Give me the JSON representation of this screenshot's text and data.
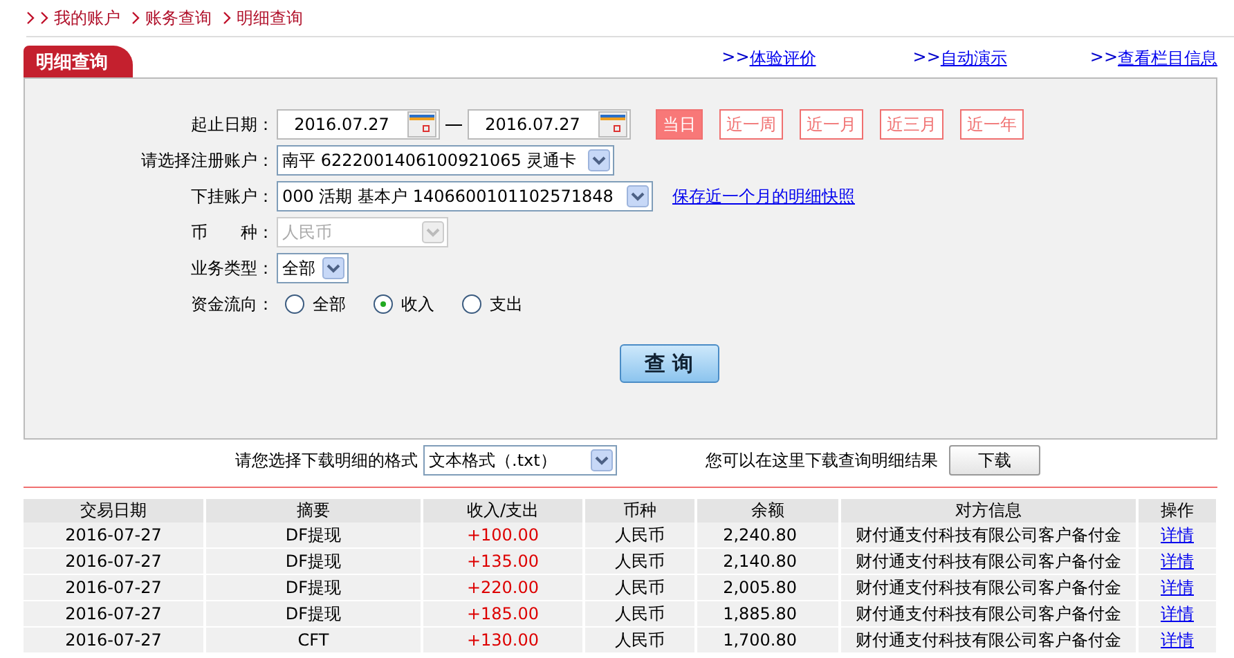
{
  "breadcrumb": [
    "我的账户",
    "账务查询",
    "明细查询"
  ],
  "tab": {
    "label": "明细查询"
  },
  "links": [
    {
      "prefix": ">>",
      "label": "体验评价"
    },
    {
      "prefix": ">>",
      "label": "自动演示"
    },
    {
      "prefix": ">>",
      "label": "查看栏目信息"
    }
  ],
  "form": {
    "date": {
      "label": "起止日期：",
      "start": "2016.07.27",
      "end": "2016.07.27"
    },
    "ranges": [
      {
        "label": "当日",
        "selected": true
      },
      {
        "label": "近一周",
        "selected": false
      },
      {
        "label": "近一月",
        "selected": false
      },
      {
        "label": "近三月",
        "selected": false
      },
      {
        "label": "近一年",
        "selected": false
      }
    ],
    "selects": [
      {
        "label": "请选择注册账户：",
        "value": "南平  6222001406100921065 灵通卡",
        "disabled": false
      },
      {
        "label": "下挂账户：",
        "value": "000 活期 基本户 1406600101102571848",
        "disabled": false,
        "link": "保存近一个月的明细快照"
      },
      {
        "label": "币　　种：",
        "value": "人民币",
        "disabled": true
      },
      {
        "label": "业务类型：",
        "value": "全部",
        "disabled": false
      }
    ],
    "flow": {
      "label": "资金流向：",
      "options": [
        {
          "label": "全部",
          "selected": false
        },
        {
          "label": "收入",
          "selected": true
        },
        {
          "label": "支出",
          "selected": false
        }
      ]
    },
    "query_button": "查 询"
  },
  "download": {
    "label": "请您选择下载明细的格式",
    "format": "文本格式（.txt）",
    "hint": "您可以在这里下载查询明细结果",
    "button": "下载"
  },
  "table": {
    "columns": [
      "交易日期",
      "摘要",
      "收入/支出",
      "币种",
      "余额",
      "对方信息",
      "操作"
    ],
    "rows": [
      [
        "2016-07-27",
        "DF提现",
        "+100.00",
        "人民币",
        "2,240.80",
        "财付通支付科技有限公司客户备付金",
        "详情"
      ],
      [
        "2016-07-27",
        "DF提现",
        "+135.00",
        "人民币",
        "2,140.80",
        "财付通支付科技有限公司客户备付金",
        "详情"
      ],
      [
        "2016-07-27",
        "DF提现",
        "+220.00",
        "人民币",
        "2,005.80",
        "财付通支付科技有限公司客户备付金",
        "详情"
      ],
      [
        "2016-07-27",
        "DF提现",
        "+185.00",
        "人民币",
        "1,885.80",
        "财付通支付科技有限公司客户备付金",
        "详情"
      ],
      [
        "2016-07-27",
        "CFT",
        "+130.00",
        "人民币",
        "1,700.80",
        "财付通支付科技有限公司客户备付金",
        "详情"
      ]
    ]
  }
}
